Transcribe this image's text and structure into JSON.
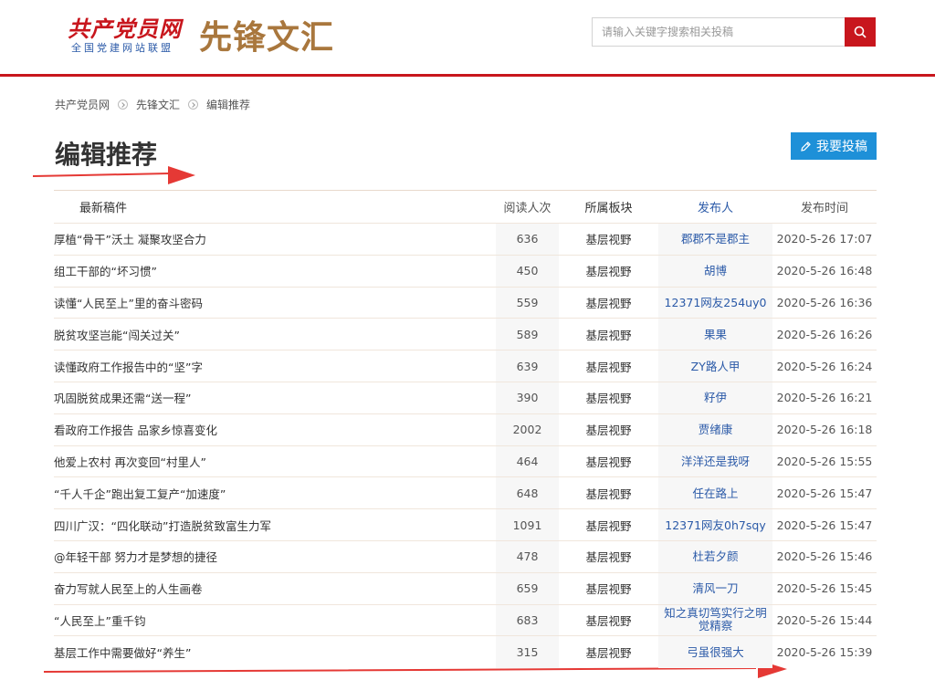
{
  "header": {
    "logo_main": "共产党员网",
    "logo_sub": "全国党建网站联盟",
    "channel_title": "先锋文汇",
    "search_placeholder": "请输入关键字搜索相关投稿"
  },
  "breadcrumb": [
    "共产党员网",
    "先锋文汇",
    "编辑推荐"
  ],
  "page_title": "编辑推荐",
  "submit_button": "我要投稿",
  "table": {
    "columns": [
      "最新稿件",
      "阅读人次",
      "所属板块",
      "发布人",
      "发布时间"
    ],
    "rows": [
      {
        "title": "厚植“骨干”沃土 凝聚攻坚合力",
        "reads": "636",
        "section": "基层视野",
        "author": "郡郡不是郡主",
        "time": "2020-5-26 17:07"
      },
      {
        "title": "组工干部的“坏习惯”",
        "reads": "450",
        "section": "基层视野",
        "author": "胡博",
        "time": "2020-5-26 16:48"
      },
      {
        "title": "读懂“人民至上”里的奋斗密码",
        "reads": "559",
        "section": "基层视野",
        "author": "12371网友254uy0",
        "time": "2020-5-26 16:36"
      },
      {
        "title": "脱贫攻坚岂能“闯关过关”",
        "reads": "589",
        "section": "基层视野",
        "author": "果果",
        "time": "2020-5-26 16:26"
      },
      {
        "title": "读懂政府工作报告中的“坚”字",
        "reads": "639",
        "section": "基层视野",
        "author": "ZY路人甲",
        "time": "2020-5-26 16:24"
      },
      {
        "title": "巩固脱贫成果还需“送一程”",
        "reads": "390",
        "section": "基层视野",
        "author": "籽伊",
        "time": "2020-5-26 16:21"
      },
      {
        "title": "看政府工作报告 品家乡惊喜变化",
        "reads": "2002",
        "section": "基层视野",
        "author": "贾绪康",
        "time": "2020-5-26 16:18"
      },
      {
        "title": "他爱上农村 再次变回“村里人”",
        "reads": "464",
        "section": "基层视野",
        "author": "洋洋还是我呀",
        "time": "2020-5-26 15:55"
      },
      {
        "title": "“千人千企”跑出复工复产“加速度”",
        "reads": "648",
        "section": "基层视野",
        "author": "任在路上",
        "time": "2020-5-26 15:47"
      },
      {
        "title": "四川广汉：“四化联动”打造脱贫致富生力军",
        "reads": "1091",
        "section": "基层视野",
        "author": "12371网友0h7sqy",
        "time": "2020-5-26 15:47"
      },
      {
        "title": "@年轻干部 努力才是梦想的捷径",
        "reads": "478",
        "section": "基层视野",
        "author": "杜若夕颜",
        "time": "2020-5-26 15:46"
      },
      {
        "title": "奋力写就人民至上的人生画卷",
        "reads": "659",
        "section": "基层视野",
        "author": "清风一刀",
        "time": "2020-5-26 15:45"
      },
      {
        "title": "“人民至上”重千钧",
        "reads": "683",
        "section": "基层视野",
        "author": "知之真切笃实行之明觉精察",
        "time": "2020-5-26 15:44"
      },
      {
        "title": "基层工作中需要做好“养生”",
        "reads": "315",
        "section": "基层视野",
        "author": "弓虽很强大",
        "time": "2020-5-26 15:39"
      }
    ]
  },
  "colors": {
    "brand_red": "#c8161d",
    "channel_gold": "#a9773d",
    "link_blue": "#2b5aa8",
    "button_blue": "#1e90d8",
    "annotation_arrow": "#e53935"
  }
}
